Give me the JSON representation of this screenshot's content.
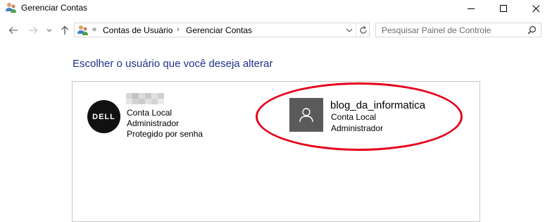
{
  "window": {
    "title": "Gerenciar Contas",
    "app_icon": "users-icon",
    "controls": [
      "minimize-icon",
      "maximize-icon",
      "close-icon"
    ]
  },
  "nav": {
    "buttons": [
      "back-icon",
      "forward-icon",
      "recent-dropdown-icon",
      "up-icon"
    ],
    "address": {
      "overflow_chevron": "«",
      "breadcrumbs": [
        "Contas de Usuário",
        "Gerenciar Contas"
      ],
      "separator": "›"
    },
    "search": {
      "placeholder": "Pesquisar Painel de Controle"
    }
  },
  "main": {
    "heading": "Escolher o usuário que você deseja alterar",
    "accounts": [
      {
        "avatar": "dell-logo",
        "name_redacted": true,
        "lines": [
          "Conta Local",
          "Administrador",
          "Protegido por senha"
        ]
      },
      {
        "avatar": "user-icon",
        "name": "blog_da_informatica",
        "lines": [
          "Conta Local",
          "Administrador"
        ],
        "highlighted": true
      }
    ]
  },
  "colors": {
    "heading": "#1e3287",
    "highlight_ring": "#e3001b",
    "user_tile": "#5a5a5a"
  },
  "dell_logo_text": "DELL"
}
